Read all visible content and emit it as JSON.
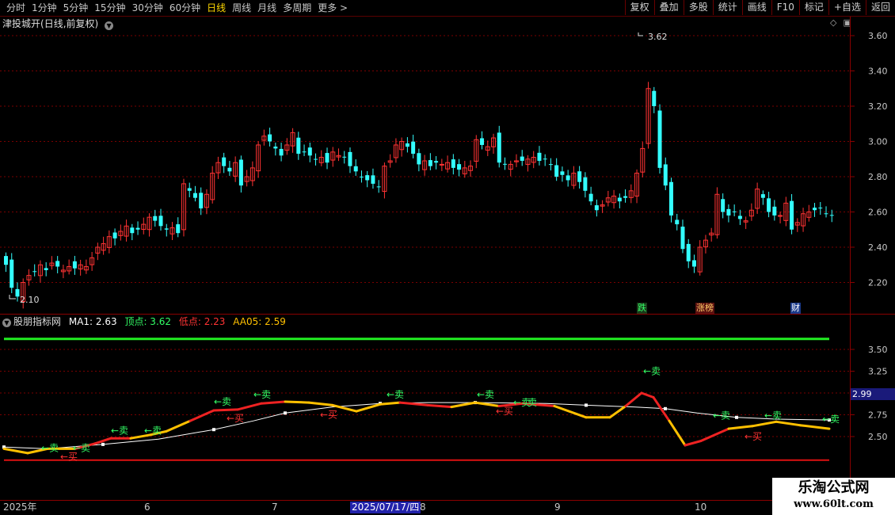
{
  "toolbar": {
    "periods": [
      "分时",
      "1分钟",
      "5分钟",
      "15分钟",
      "30分钟",
      "60分钟",
      "日线",
      "周线",
      "月线",
      "多周期",
      "更多 >"
    ],
    "active_period": "日线",
    "right_tools": [
      "复权",
      "叠加",
      "多股",
      "统计",
      "画线",
      "F10",
      "标记",
      "+自选",
      "返回"
    ]
  },
  "chart_header": {
    "stock_name": "津投城开",
    "mode": "(日线,前复权)"
  },
  "price_panel": {
    "y_ticks": [
      "3.60",
      "3.40",
      "3.20",
      "3.00",
      "2.80",
      "2.60",
      "2.40",
      "2.20"
    ],
    "high_marker": "3.62",
    "low_marker": "2.10",
    "event_tags": [
      {
        "label": "跌",
        "color": "#33ff66",
        "bg": "#1a3a1a"
      },
      {
        "label": "涨榜",
        "color": "#ffcc66",
        "bg": "#5a1010"
      },
      {
        "label": "财",
        "color": "#ffffff",
        "bg": "#1a3a8a"
      }
    ]
  },
  "indicator_panel": {
    "name": "股朋指标网",
    "ma1_label": "MA1: 2.63",
    "top_label": "顶点: 3.62",
    "low_label": "低点: 2.23",
    "aa05_label": "AA05: 2.59",
    "y_ticks": [
      "3.50",
      "3.25",
      "3.00",
      "2.75",
      "2.50"
    ],
    "current_value": "2.99",
    "sell_label": "←卖",
    "sell_double_label": "←卖 卖",
    "buy_label": "←买"
  },
  "x_axis": {
    "labels": [
      "2025年",
      "6",
      "7",
      "2025/07/17/四",
      "8",
      "9",
      "10"
    ],
    "highlighted": "2025/07/17/四"
  },
  "watermark": {
    "line1": "乐淘公式网",
    "line2": "www.60lt.com"
  },
  "colors": {
    "up": "#ff3333",
    "down": "#33ffff",
    "grid": "#8a0000",
    "sell": "#33ff66",
    "buy": "#ff3333",
    "line_yellow": "#ffc000",
    "line_white": "#ffffff"
  }
}
